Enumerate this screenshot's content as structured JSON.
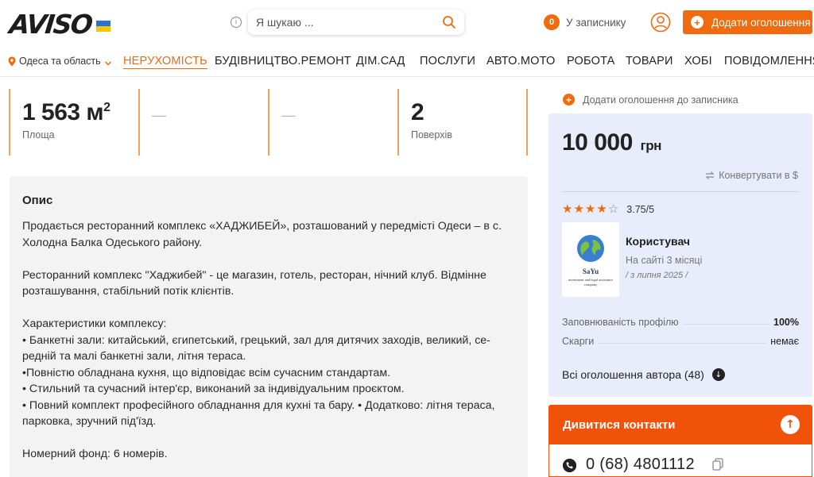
{
  "header": {
    "logo": "AVISO",
    "search_placeholder": "Я шукаю ...",
    "notepad_count": "0",
    "notepad_label": "У записнику",
    "add_button": "Додати оголошення",
    "add_plus": "+"
  },
  "nav": {
    "region": "Одеса та область",
    "items": [
      {
        "label": "НЕРУХОМІСТЬ",
        "active": true
      },
      {
        "label": "БУДІВНИЦТВО.РЕМОНТ"
      },
      {
        "label": "ДІМ.САД"
      },
      {
        "label": "ПОСЛУГИ"
      },
      {
        "label": "АВТО.МОТО"
      },
      {
        "label": "РОБОТА"
      },
      {
        "label": "ТОВАРИ"
      },
      {
        "label": "ХОБІ"
      },
      {
        "label": "ПОВІДОМЛЕННЯ"
      }
    ]
  },
  "stats": [
    {
      "value": "1 563 м",
      "sup": "2",
      "label": "Площа"
    },
    {
      "value": "—",
      "label": ""
    },
    {
      "value": "—",
      "label": ""
    },
    {
      "value": "2",
      "label": "Поверхів"
    }
  ],
  "description": {
    "title": "Опис",
    "p1": "Продається ресторанний комплекс «ХАДЖИБЕЙ», розташований у передмісті Одеси – в с. Холодна Балка Одеського району.",
    "p2": "Ресторанний комплекс \"Хаджибей\" - це магазин, готель, ресторан, нічний клуб. Відмінне розташування, стабільний потік клієнтів.",
    "features_title": "Характеристики комплексу:",
    "f1": "• Банкетні зали: китайський, єгипетський, грецький, зал для дитячих заходів, великий, се-редній та малі банкетні зали, літня тераса.",
    "f2": "•Повністю обладнана кухня, що відповідає всім сучасним стандартам.",
    "f3": "• Стильний та сучасний інтер'єр, виконаний за індивідуальним проєктом.",
    "f4": "• Повний комплект професійного обладнання для кухні та бару. • Додатково: літня тераса, парковка, зручний під'їзд.",
    "rooms": "Номерний фонд: 6 номерів."
  },
  "sidebar": {
    "bookmark": "Додати оголошення до записника",
    "price": "10 000",
    "currency": "грн",
    "convert": "Конвертувати в $",
    "rating": "3.75/5",
    "rating_value": 3.75,
    "avatar_name": "SaYu",
    "avatar_sub": "investment and legal assistance company",
    "user_name": "Користувач",
    "user_since": "На сайті 3 місяці",
    "user_date": "/ з липня 2025 /",
    "profile_label": "Заповнюваність профілю",
    "profile_value": "100%",
    "complaints_label": "Скарги",
    "complaints_value": "немає",
    "all_ads": "Всі оголошення автора (48)",
    "contacts_button": "Дивитися контакти",
    "phone": "0 (68) 4801112"
  },
  "colors": {
    "accent": "#f06a0f",
    "card_bg": "#e9ecfb",
    "contact_btn": "#f0520a"
  }
}
